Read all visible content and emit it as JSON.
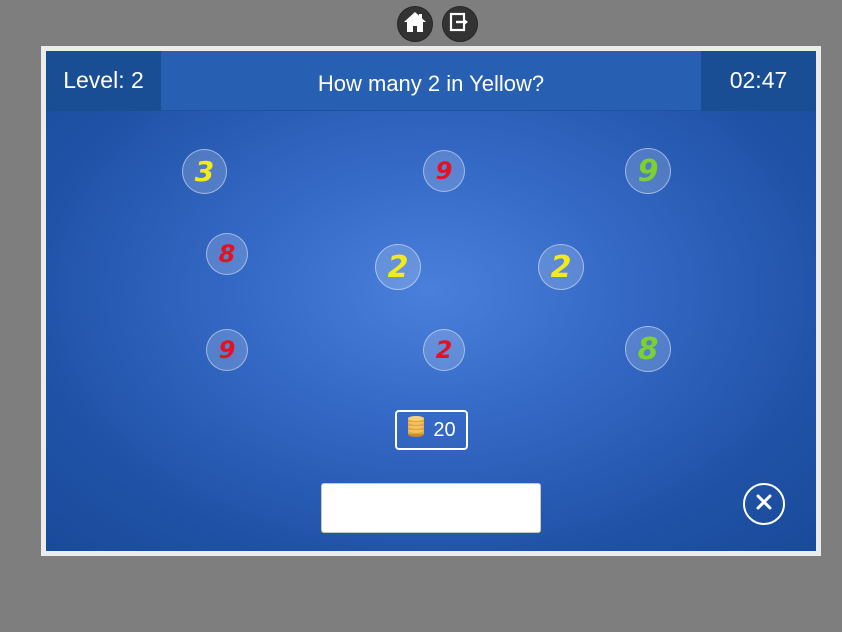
{
  "toolbar": {
    "home_icon": "home-icon",
    "exit_icon": "exit-icon"
  },
  "header": {
    "level": "Level: 2",
    "question": "How many 2 in Yellow?",
    "timer": "02:47"
  },
  "numbers": [
    {
      "digit": "3",
      "color": "#f2ea1c"
    },
    {
      "digit": "9",
      "color": "#e8101e"
    },
    {
      "digit": "9",
      "color": "#7cd12e"
    },
    {
      "digit": "8",
      "color": "#e8101e"
    },
    {
      "digit": "2",
      "color": "#f2ea1c"
    },
    {
      "digit": "2",
      "color": "#f2ea1c"
    },
    {
      "digit": "9",
      "color": "#e8101e"
    },
    {
      "digit": "2",
      "color": "#e8101e"
    },
    {
      "digit": "8",
      "color": "#7cd12e"
    }
  ],
  "coins": {
    "icon": "coin-stack-icon",
    "value": "20"
  },
  "answer": {
    "value": "",
    "placeholder": ""
  },
  "close": {
    "icon": "close-icon"
  },
  "colors": {
    "background": "#7e7e7e",
    "board": "#2a5fb8",
    "header_dark": "#1a4e94",
    "yellow": "#f2ea1c",
    "red": "#e8101e",
    "green": "#7cd12e"
  }
}
